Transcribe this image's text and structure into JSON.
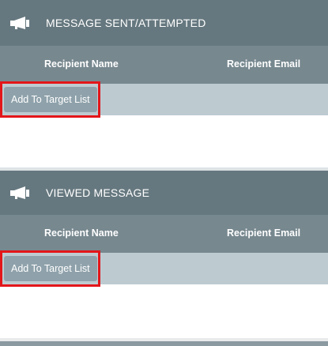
{
  "colors": {
    "header_bg": "#66787f",
    "columns_bg": "#77888f",
    "action_row_bg": "#bdcbd1",
    "button_bg": "#8fa2ab",
    "highlight": "#e3161a"
  },
  "panels": [
    {
      "icon": "megaphone-icon",
      "title": "MESSAGE SENT/ATTEMPTED",
      "columns": {
        "name": "Recipient Name",
        "email": "Recipient Email"
      },
      "action_label": "Add To Target List"
    },
    {
      "icon": "megaphone-icon",
      "title": "VIEWED MESSAGE",
      "columns": {
        "name": "Recipient Name",
        "email": "Recipient Email"
      },
      "action_label": "Add To Target List"
    }
  ]
}
